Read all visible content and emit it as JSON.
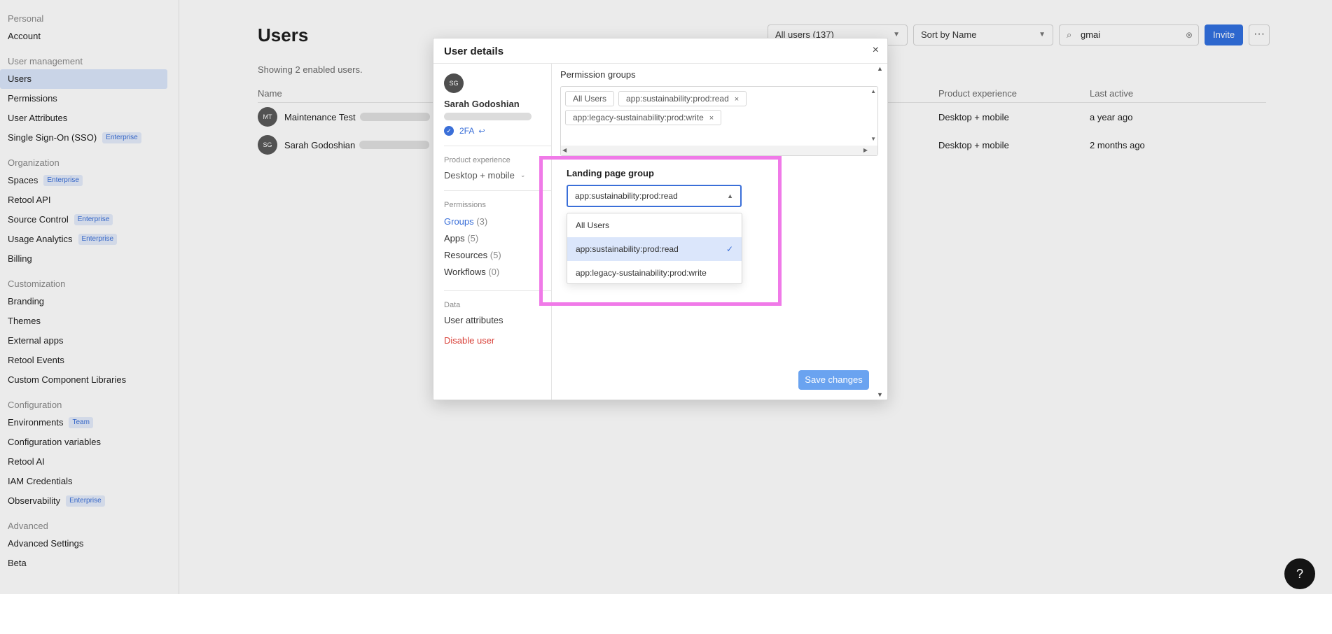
{
  "sidebar": {
    "sections": [
      {
        "title": "Personal",
        "items": [
          {
            "label": "Account"
          }
        ]
      },
      {
        "title": "User management",
        "items": [
          {
            "label": "Users",
            "active": true
          },
          {
            "label": "Permissions"
          },
          {
            "label": "User Attributes"
          },
          {
            "label": "Single Sign-On (SSO)",
            "badge": "Enterprise"
          }
        ]
      },
      {
        "title": "Organization",
        "items": [
          {
            "label": "Spaces",
            "badge": "Enterprise"
          },
          {
            "label": "Retool API"
          },
          {
            "label": "Source Control",
            "badge": "Enterprise"
          },
          {
            "label": "Usage Analytics",
            "badge": "Enterprise"
          },
          {
            "label": "Billing"
          }
        ]
      },
      {
        "title": "Customization",
        "items": [
          {
            "label": "Branding"
          },
          {
            "label": "Themes"
          },
          {
            "label": "External apps"
          },
          {
            "label": "Retool Events"
          },
          {
            "label": "Custom Component Libraries"
          }
        ]
      },
      {
        "title": "Configuration",
        "items": [
          {
            "label": "Environments",
            "badge": "Team"
          },
          {
            "label": "Configuration variables"
          },
          {
            "label": "Retool AI"
          },
          {
            "label": "IAM Credentials"
          },
          {
            "label": "Observability",
            "badge": "Enterprise"
          }
        ]
      },
      {
        "title": "Advanced",
        "items": [
          {
            "label": "Advanced Settings"
          },
          {
            "label": "Beta"
          }
        ]
      }
    ]
  },
  "main": {
    "title": "Users",
    "subtitle": "Showing 2 enabled users.",
    "filter_select": "All users (137)",
    "sort_select": "Sort by Name",
    "search_value": "gmai",
    "invite_label": "Invite",
    "more_label": "···",
    "columns": {
      "name": "Name",
      "experience": "Product experience",
      "last_active": "Last active"
    },
    "rows": [
      {
        "initials": "MT",
        "name": "Maintenance Test",
        "experience": "Desktop + mobile",
        "last_active": "a year ago"
      },
      {
        "initials": "SG",
        "name": "Sarah Godoshian",
        "experience": "Desktop + mobile",
        "last_active": "2 months ago"
      }
    ]
  },
  "modal": {
    "title": "User details",
    "close": "×",
    "user": {
      "initials": "SG",
      "name": "Sarah Godoshian",
      "twofa": "2FA"
    },
    "product_experience": {
      "label": "Product experience",
      "value": "Desktop + mobile"
    },
    "permissions": {
      "label": "Permissions",
      "items": [
        {
          "label": "Groups",
          "count": "(3)",
          "active": true
        },
        {
          "label": "Apps",
          "count": "(5)"
        },
        {
          "label": "Resources",
          "count": "(5)"
        },
        {
          "label": "Workflows",
          "count": "(0)"
        }
      ]
    },
    "data": {
      "label": "Data",
      "user_attributes": "User attributes"
    },
    "disable_user": "Disable user",
    "permission_groups": {
      "label": "Permission groups",
      "chips": [
        {
          "label": "All Users",
          "removable": false
        },
        {
          "label": "app:sustainability:prod:read",
          "removable": true
        },
        {
          "label": "app:legacy-sustainability:prod:write",
          "removable": true
        }
      ]
    },
    "landing_page_group": {
      "label": "Landing page group",
      "value": "app:sustainability:prod:read",
      "options": [
        {
          "label": "All Users"
        },
        {
          "label": "app:sustainability:prod:read",
          "selected": true
        },
        {
          "label": "app:legacy-sustainability:prod:write"
        }
      ]
    },
    "save_label": "Save changes"
  },
  "colors": {
    "accent": "#3170e0",
    "highlight": "#f07ae8",
    "danger": "#d9423a"
  }
}
